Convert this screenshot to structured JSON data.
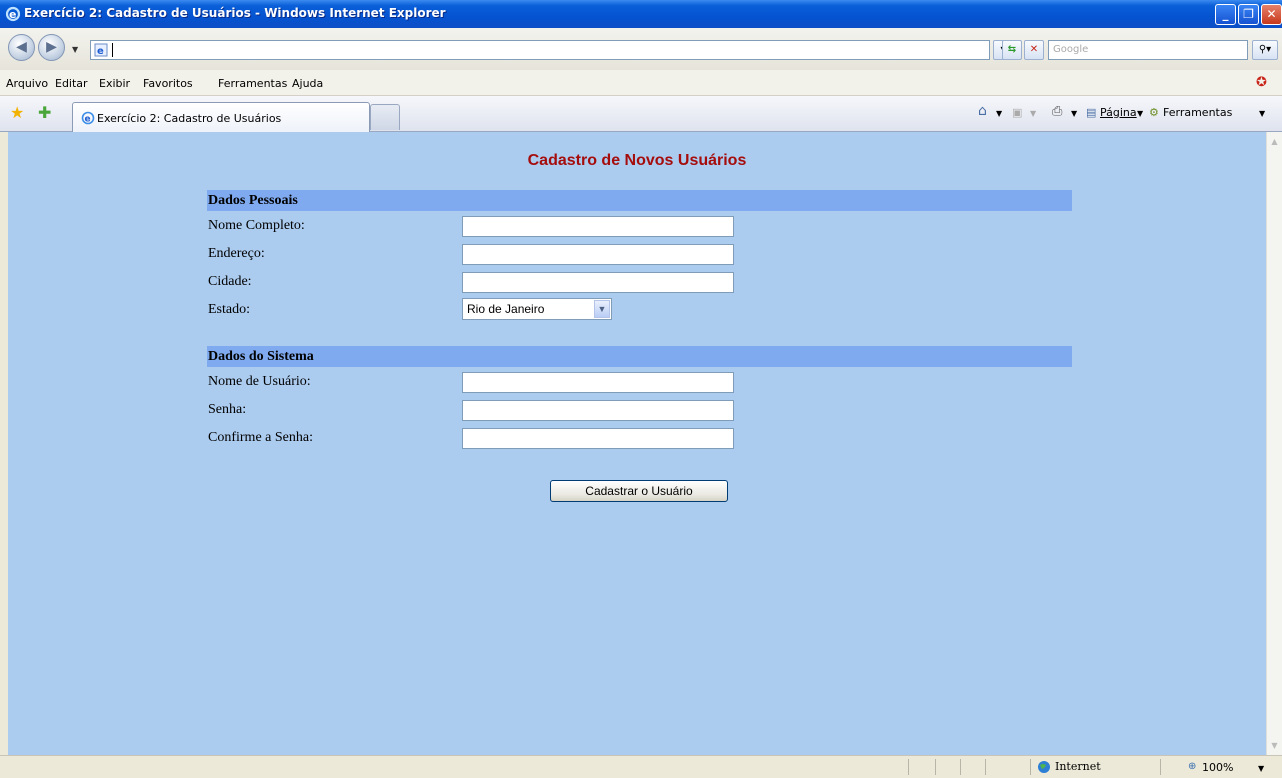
{
  "window": {
    "title": "Exercício 2: Cadastro de Usuários - Windows Internet Explorer"
  },
  "address_bar": {
    "url": "",
    "search_placeholder": "Google"
  },
  "menu": {
    "items": [
      "Arquivo",
      "Editar",
      "Exibir",
      "Favoritos",
      "Ferramentas",
      "Ajuda"
    ]
  },
  "tabs": {
    "active_label": "Exercício 2: Cadastro de Usuários"
  },
  "command_bar": {
    "page_label": "Página",
    "tools_label": "Ferramentas"
  },
  "form": {
    "title": "Cadastro de Novos Usuários",
    "sections": [
      {
        "header": "Dados Pessoais",
        "fields": [
          "Nome Completo:",
          "Endereço:",
          "Cidade:",
          "Estado:"
        ]
      },
      {
        "header": "Dados do Sistema",
        "fields": [
          "Nome de Usuário:",
          "Senha:",
          "Confirme a Senha:"
        ]
      }
    ],
    "state_selected": "Rio de Janeiro",
    "submit_label": "Cadastrar o Usuário"
  },
  "status_bar": {
    "zone": "Internet",
    "zoom": "100%"
  },
  "colors": {
    "page_background": "#abcbef",
    "section_header": "#80aaef",
    "title_text": "#a50d0d"
  }
}
